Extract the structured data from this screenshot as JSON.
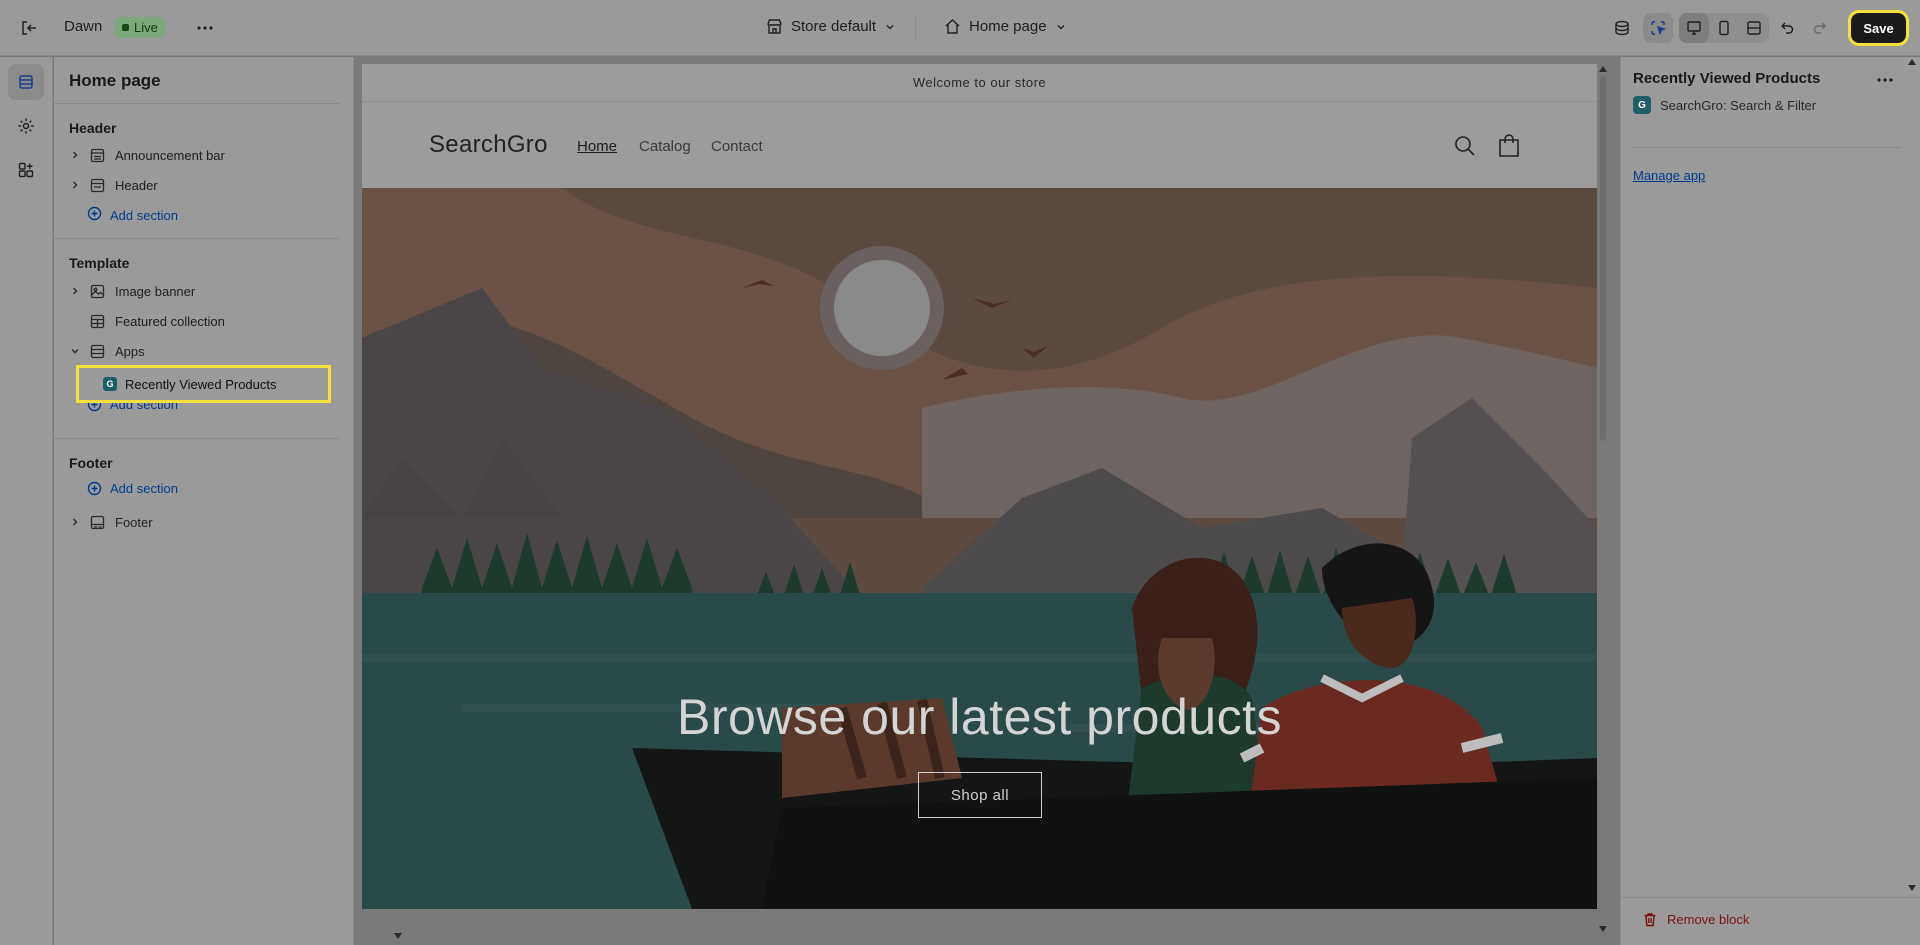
{
  "topbar": {
    "theme_name": "Dawn",
    "live_badge": "Live",
    "store_selector": "Store default",
    "page_selector": "Home page",
    "save_label": "Save"
  },
  "sidebar": {
    "title": "Home page",
    "groups": {
      "header": {
        "title": "Header",
        "items": [
          "Announcement bar",
          "Header"
        ],
        "add_label": "Add section"
      },
      "template": {
        "title": "Template",
        "items": [
          "Image banner",
          "Featured collection",
          "Apps"
        ],
        "selected_block": "Recently Viewed Products",
        "add_label": "Add section"
      },
      "footer": {
        "title": "Footer",
        "add_label": "Add section",
        "items": [
          "Footer"
        ]
      }
    }
  },
  "preview": {
    "announcement": "Welcome to our store",
    "store_name": "SearchGro",
    "nav": [
      "Home",
      "Catalog",
      "Contact"
    ],
    "hero_heading": "Browse our latest products",
    "hero_button": "Shop all"
  },
  "right_panel": {
    "title": "Recently Viewed Products",
    "app_name": "SearchGro: Search & Filter",
    "app_icon_letter": "G",
    "manage_link": "Manage app",
    "remove_label": "Remove block"
  },
  "colors": {
    "accent_highlight": "#f5e13a",
    "link": "#003b8a",
    "live_badge": "#7da87e",
    "danger": "#7a1010"
  }
}
